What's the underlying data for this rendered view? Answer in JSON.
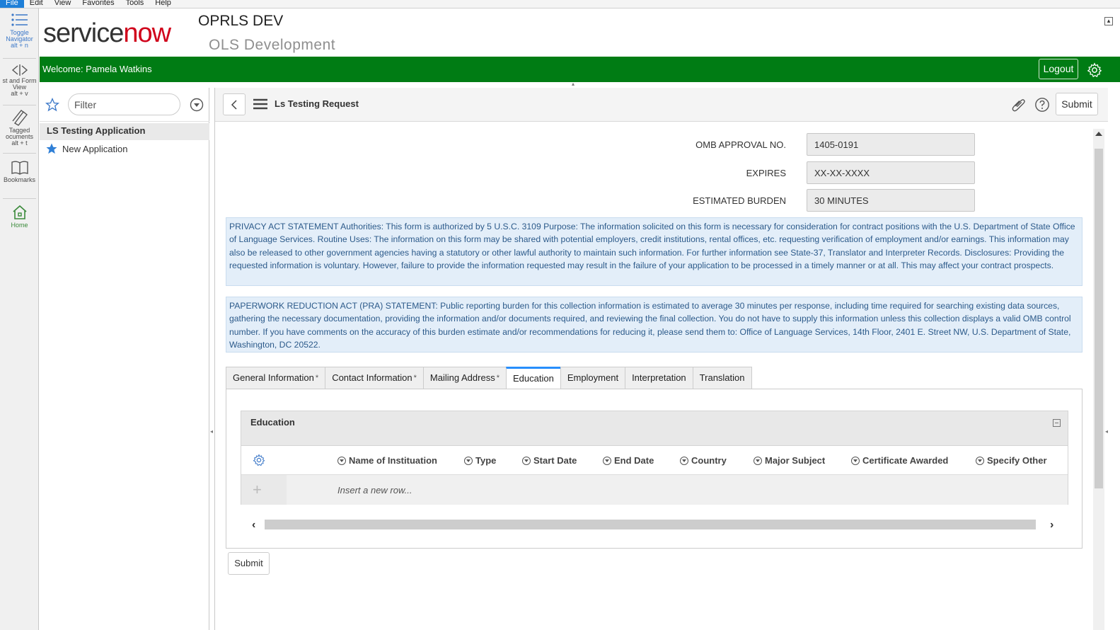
{
  "menubar": {
    "items": [
      "File",
      "Edit",
      "View",
      "Favorites",
      "Tools",
      "Help"
    ]
  },
  "rail": {
    "toggle_navigator": {
      "label1": "Toggle",
      "label2": "Navigator",
      "shortcut": "alt + n"
    },
    "list_form_view": {
      "label1": "st and Form",
      "label2": "View",
      "shortcut": "alt + v"
    },
    "tagged_documents": {
      "label1": "Tagged",
      "label2": "ocuments",
      "shortcut": "alt + t"
    },
    "bookmarks": {
      "label": "Bookmarks"
    },
    "home": {
      "label": "Home"
    }
  },
  "header": {
    "logo_service": "service",
    "logo_now": "now",
    "instance_name": "OPRLS DEV",
    "instance_subtitle": "OLS Development"
  },
  "greenbar": {
    "welcome": "Welcome:  Pamela Watkins",
    "logout_label": "Logout"
  },
  "navigator": {
    "filter_placeholder": "Filter",
    "application": "LS Testing Application",
    "module": "New Application"
  },
  "form": {
    "title": "Ls Testing Request",
    "submit_label": "Submit",
    "fields": [
      {
        "label": "OMB APPROVAL NO.",
        "value": "1405-0191"
      },
      {
        "label": "EXPIRES",
        "value": "XX-XX-XXXX"
      },
      {
        "label": "ESTIMATED BURDEN",
        "value": "30 MINUTES"
      }
    ],
    "privacy_statement": "PRIVACY ACT STATEMENT Authorities: This form is authorized by 5 U.S.C. 3109 Purpose: The information solicited on this form is necessary for consideration for contract positions with the U.S. Department of State Office of Language Services. Routine Uses: The information on this form may be shared with potential employers, credit institutions, rental offices, etc. requesting verification of employment and/or earnings. This information may also be released to other government agencies having a statutory or other lawful authority to maintain such information. For further information see State-37, Translator and Interpreter Records. Disclosures: Providing the requested information is voluntary. However, failure to provide the information requested may result in the failure of your application to be processed in a timely manner or at all. This may affect your contract prospects.",
    "pra_statement": "PAPERWORK REDUCTION ACT (PRA) STATEMENT: Public reporting burden for this collection information is estimated to average 30 minutes per response, including time required for searching existing data sources, gathering the necessary documentation, providing the information and/or documents required, and reviewing the final collection. You do not have to supply this information unless this collection displays a valid OMB control number. If you have comments on the accuracy of this burden estimate and/or recommendations for reducing it, please send them to: Office of Language Services, 14th Floor, 2401 E. Street NW, U.S. Department of State, Washington, DC 20522.",
    "tabs": [
      {
        "label": "General Information",
        "required": "*"
      },
      {
        "label": "Contact Information",
        "required": "*"
      },
      {
        "label": "Mailing Address",
        "required": "*"
      },
      {
        "label": "Education",
        "required": ""
      },
      {
        "label": "Employment",
        "required": ""
      },
      {
        "label": "Interpretation",
        "required": ""
      },
      {
        "label": "Translation",
        "required": ""
      }
    ],
    "active_tab": "Education",
    "related_list": {
      "title": "Education",
      "columns": [
        "Name of Instituation",
        "Type",
        "Start Date",
        "End Date",
        "Country",
        "Major Subject",
        "Certificate Awarded",
        "Specify Other"
      ],
      "insert_text": "Insert a new row..."
    },
    "bottom_submit_label": "Submit"
  },
  "colors": {
    "brand_green": "#007c14",
    "accent_blue": "#278efc",
    "info_bg": "#e3eef9",
    "logo_red": "#d0021b"
  }
}
